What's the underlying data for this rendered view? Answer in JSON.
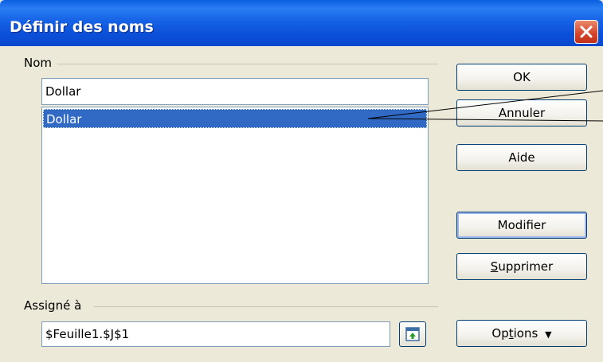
{
  "window": {
    "title": "Définir des noms"
  },
  "name_group": {
    "label": "Nom",
    "input_value": "Dollar",
    "list_items": [
      "Dollar"
    ]
  },
  "assign_group": {
    "label": "Assigné à",
    "input_value": "$Feuille1.$J$1"
  },
  "buttons": {
    "ok": "OK",
    "cancel": "Annuler",
    "help": "Aide",
    "modify": "Modifier",
    "delete_ul": "S",
    "delete_rest": "upprimer",
    "options_pre": "Op",
    "options_ul": "t",
    "options_post": "ions",
    "options_arrow": "▼"
  },
  "colors": {
    "title_bar": "#0a5fdf",
    "selection": "#316ac5",
    "dialog_bg": "#ece9d8"
  },
  "icons": [
    "close-icon",
    "shrink-icon",
    "double-chevron-down-icon"
  ]
}
